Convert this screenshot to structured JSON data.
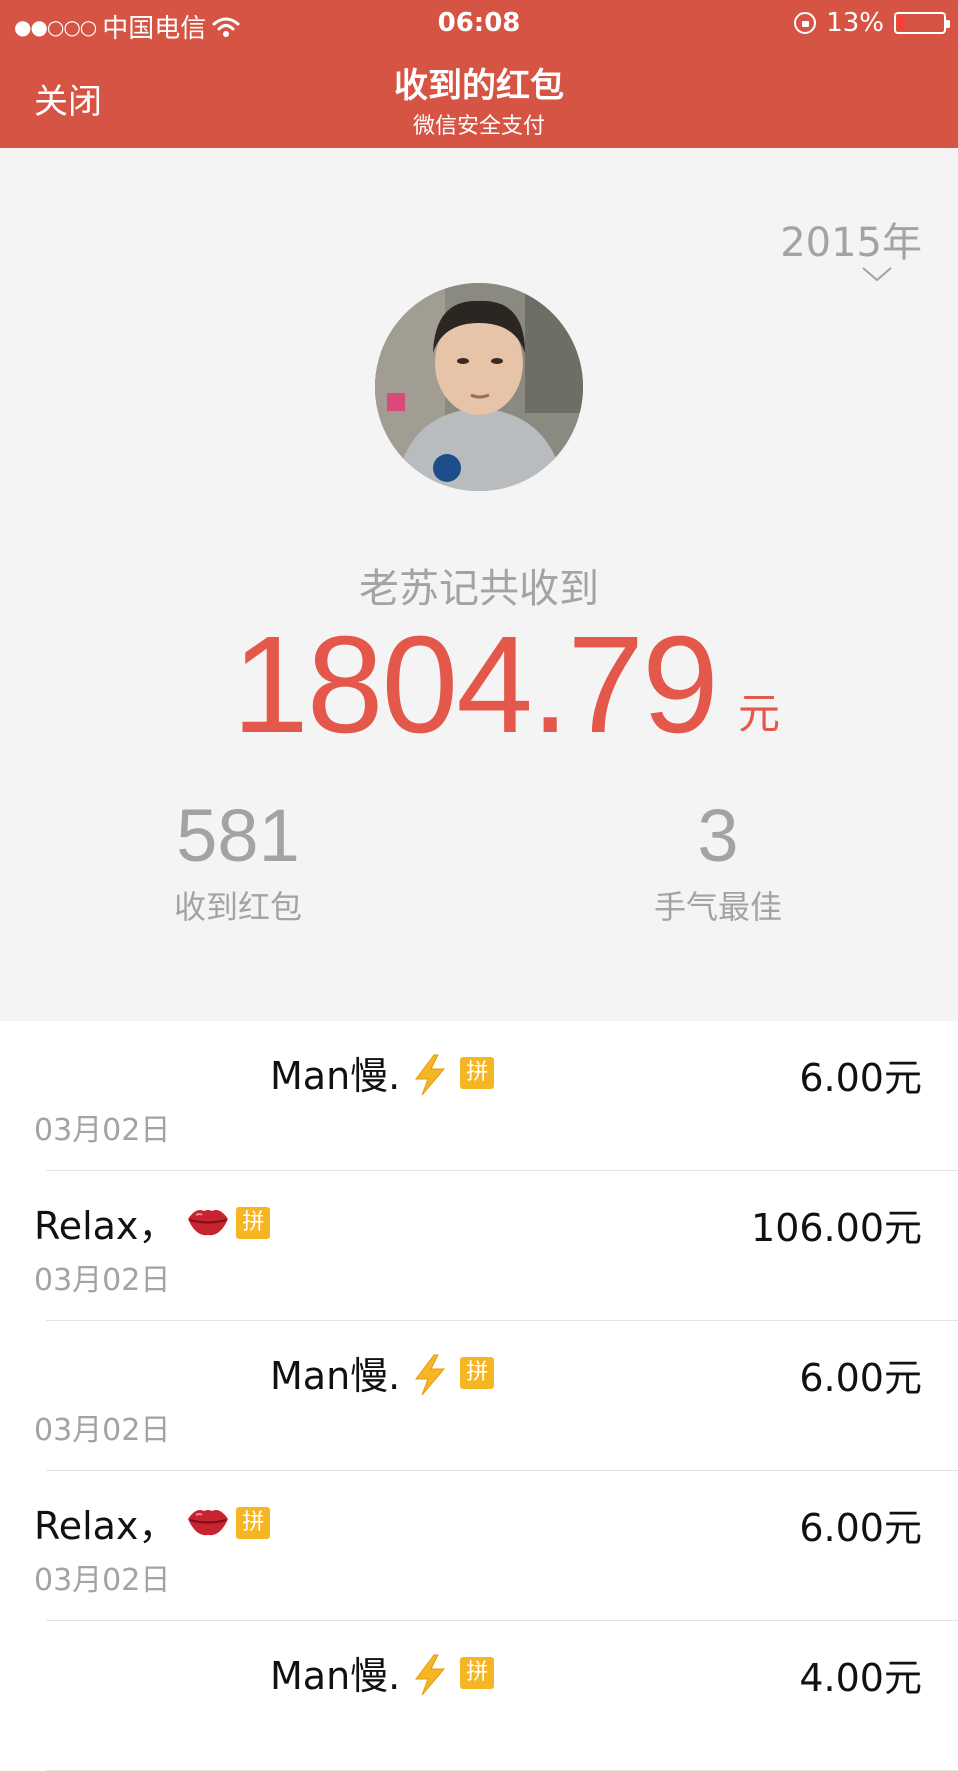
{
  "status_bar": {
    "carrier": "中国电信",
    "signal": "●●○○○",
    "time": "06:08",
    "battery": "13%",
    "battery_level": 0.13
  },
  "nav": {
    "close": "关闭",
    "title": "收到的红包",
    "subtitle": "微信安全支付"
  },
  "summary": {
    "year": "2015年",
    "total_label": "老苏记共收到",
    "total_amount": "1804.79",
    "total_unit": "元",
    "stats": [
      {
        "value": "581",
        "label": "收到红包"
      },
      {
        "value": "3",
        "label": "手气最佳"
      }
    ]
  },
  "records": [
    {
      "name": "Man慢.",
      "emoji": "lightning-icon",
      "badge": "拼",
      "amount": "6.00元",
      "date": "03月02日"
    },
    {
      "name": "Relax，",
      "emoji": "lips-icon",
      "badge": "拼",
      "amount": "106.00元",
      "date": "03月02日"
    },
    {
      "name": "Man慢.",
      "emoji": "lightning-icon",
      "badge": "拼",
      "amount": "6.00元",
      "date": "03月02日"
    },
    {
      "name": "Relax，",
      "emoji": "lips-icon",
      "badge": "拼",
      "amount": "6.00元",
      "date": "03月02日"
    },
    {
      "name": "Man慢.",
      "emoji": "lightning-icon",
      "badge": "拼",
      "amount": "4.00元",
      "date": ""
    }
  ],
  "colors": {
    "header": "#d65444",
    "amount": "#e4574b",
    "muted": "#a3a3a3",
    "badge": "#f6b623"
  }
}
